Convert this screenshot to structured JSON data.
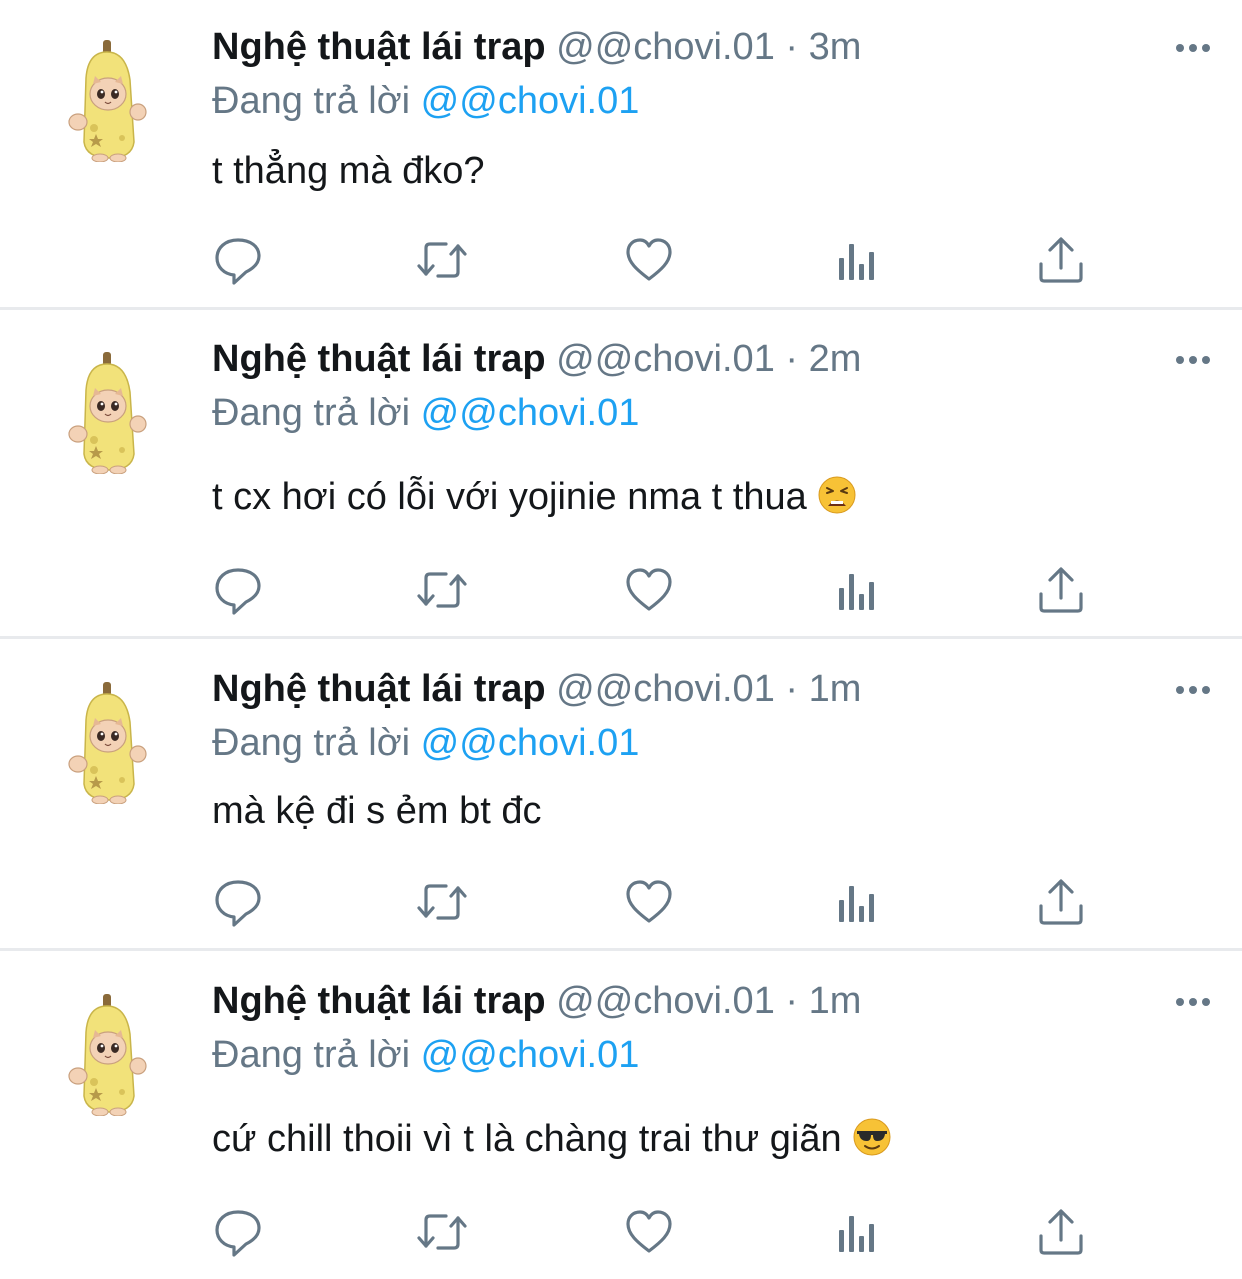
{
  "colors": {
    "name": "#14171a",
    "secondary": "#657786",
    "mention": "#1da1f2",
    "icon": "#657786",
    "divider": "#e8eaed"
  },
  "tweets": [
    {
      "name": "Nghệ thuật lái trap",
      "handle": "@@chovi.01",
      "dot": "·",
      "time": "3m",
      "replying_label": "Đang trả lời",
      "replying_to": "@@chovi.01",
      "text": "t thẳng mà đko?",
      "emoji": ""
    },
    {
      "name": "Nghệ thuật lái trap",
      "handle": "@@chovi.01",
      "dot": "·",
      "time": "2m",
      "replying_label": "Đang trả lời",
      "replying_to": "@@chovi.01",
      "text": "t cx hơi có lỗi với yojinie nma t thua",
      "emoji": "weary-face-emoji"
    },
    {
      "name": "Nghệ thuật lái trap",
      "handle": "@@chovi.01",
      "dot": "·",
      "time": "1m",
      "replying_label": "Đang trả lời",
      "replying_to": "@@chovi.01",
      "text": "mà kệ đi s ẻm bt đc",
      "emoji": ""
    },
    {
      "name": "Nghệ thuật lái trap",
      "handle": "@@chovi.01",
      "dot": "·",
      "time": "1m",
      "replying_label": "Đang trả lời",
      "replying_to": "@@chovi.01",
      "text": "cứ chill thoii vì t là chàng trai thư giãn",
      "emoji": "sunglasses-face-emoji"
    }
  ],
  "icons": {
    "avatar": "banana-cat-avatar",
    "more": "more-options-icon",
    "reply": "reply-icon",
    "retweet": "retweet-icon",
    "like": "heart-icon",
    "analytics": "analytics-icon",
    "share": "share-icon"
  }
}
